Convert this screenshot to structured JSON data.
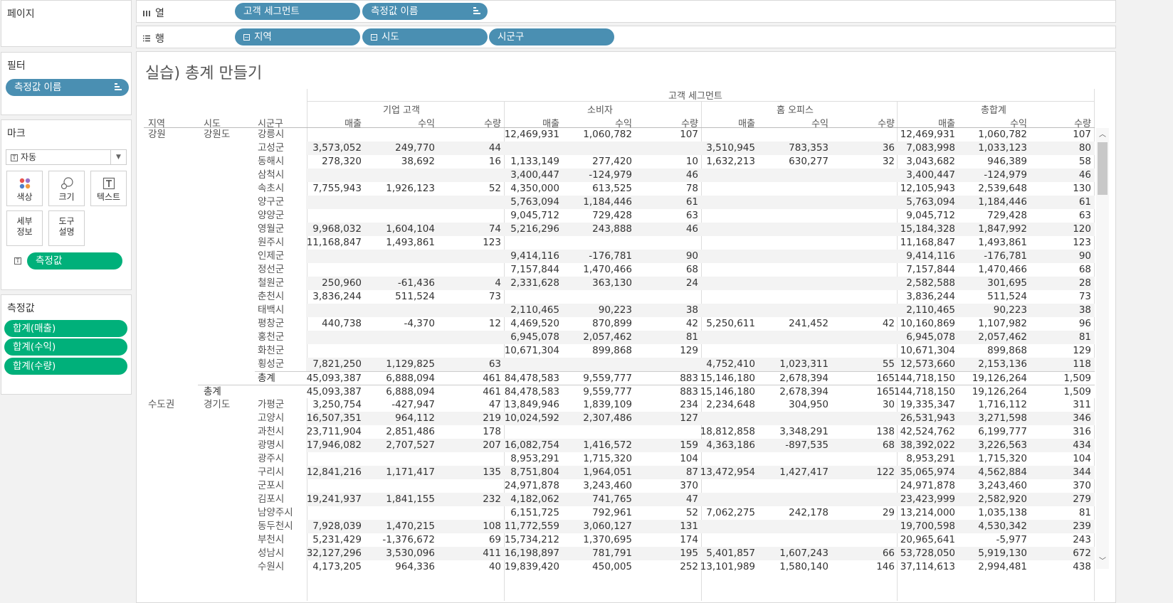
{
  "shelves": {
    "pages_label": "페이지",
    "columns_label": "열",
    "rows_label": "행",
    "column_pills": [
      "고객 세그먼트",
      "측정값 이름"
    ],
    "row_pills": [
      "지역",
      "시도",
      "시군구"
    ]
  },
  "filters": {
    "title": "필터",
    "pill": "측정값 이름"
  },
  "marks": {
    "title": "마크",
    "type": "자동",
    "buttons": {
      "color": "색상",
      "size": "크기",
      "text": "텍스트",
      "detail_1": "세부",
      "detail_2": "정보",
      "tooltip_1": "도구",
      "tooltip_2": "설명"
    },
    "measure_pill": "측정값"
  },
  "measures": {
    "title": "측정값",
    "pills": [
      "합계(매출)",
      "합계(수익)",
      "합계(수량)"
    ]
  },
  "viz": {
    "title": "실습) 총계 만들기",
    "segment_header": "고객 세그먼트",
    "segments": [
      "기업 고객",
      "소비자",
      "홈 오피스",
      "총합계"
    ],
    "measure_names": [
      "매출",
      "수익",
      "수량"
    ],
    "row_headers": [
      "지역",
      "시도",
      "시군구"
    ]
  },
  "table": {
    "rows": [
      {
        "region": "강원",
        "sido": "강원도",
        "sigungu": "강릉시",
        "v": [
          "",
          "",
          "",
          "12,469,931",
          "1,060,782",
          "107",
          "",
          "",
          "",
          "12,469,931",
          "1,060,782",
          "107"
        ]
      },
      {
        "region": "",
        "sido": "",
        "sigungu": "고성군",
        "v": [
          "3,573,052",
          "249,770",
          "44",
          "",
          "",
          "",
          "3,510,945",
          "783,353",
          "36",
          "7,083,998",
          "1,033,123",
          "80"
        ]
      },
      {
        "region": "",
        "sido": "",
        "sigungu": "동해시",
        "v": [
          "278,320",
          "38,692",
          "16",
          "1,133,149",
          "277,420",
          "10",
          "1,632,213",
          "630,277",
          "32",
          "3,043,682",
          "946,389",
          "58"
        ]
      },
      {
        "region": "",
        "sido": "",
        "sigungu": "삼척시",
        "v": [
          "",
          "",
          "",
          "3,400,447",
          "-124,979",
          "46",
          "",
          "",
          "",
          "3,400,447",
          "-124,979",
          "46"
        ]
      },
      {
        "region": "",
        "sido": "",
        "sigungu": "속초시",
        "v": [
          "7,755,943",
          "1,926,123",
          "52",
          "4,350,000",
          "613,525",
          "78",
          "",
          "",
          "",
          "12,105,943",
          "2,539,648",
          "130"
        ]
      },
      {
        "region": "",
        "sido": "",
        "sigungu": "양구군",
        "v": [
          "",
          "",
          "",
          "5,763,094",
          "1,184,446",
          "61",
          "",
          "",
          "",
          "5,763,094",
          "1,184,446",
          "61"
        ]
      },
      {
        "region": "",
        "sido": "",
        "sigungu": "양양군",
        "v": [
          "",
          "",
          "",
          "9,045,712",
          "729,428",
          "63",
          "",
          "",
          "",
          "9,045,712",
          "729,428",
          "63"
        ]
      },
      {
        "region": "",
        "sido": "",
        "sigungu": "영월군",
        "v": [
          "9,968,032",
          "1,604,104",
          "74",
          "5,216,296",
          "243,888",
          "46",
          "",
          "",
          "",
          "15,184,328",
          "1,847,992",
          "120"
        ]
      },
      {
        "region": "",
        "sido": "",
        "sigungu": "원주시",
        "v": [
          "11,168,847",
          "1,493,861",
          "123",
          "",
          "",
          "",
          "",
          "",
          "",
          "11,168,847",
          "1,493,861",
          "123"
        ]
      },
      {
        "region": "",
        "sido": "",
        "sigungu": "인제군",
        "v": [
          "",
          "",
          "",
          "9,414,116",
          "-176,781",
          "90",
          "",
          "",
          "",
          "9,414,116",
          "-176,781",
          "90"
        ]
      },
      {
        "region": "",
        "sido": "",
        "sigungu": "정선군",
        "v": [
          "",
          "",
          "",
          "7,157,844",
          "1,470,466",
          "68",
          "",
          "",
          "",
          "7,157,844",
          "1,470,466",
          "68"
        ]
      },
      {
        "region": "",
        "sido": "",
        "sigungu": "철원군",
        "v": [
          "250,960",
          "-61,436",
          "4",
          "2,331,628",
          "363,130",
          "24",
          "",
          "",
          "",
          "2,582,588",
          "301,695",
          "28"
        ]
      },
      {
        "region": "",
        "sido": "",
        "sigungu": "춘천시",
        "v": [
          "3,836,244",
          "511,524",
          "73",
          "",
          "",
          "",
          "",
          "",
          "",
          "3,836,244",
          "511,524",
          "73"
        ]
      },
      {
        "region": "",
        "sido": "",
        "sigungu": "태백시",
        "v": [
          "",
          "",
          "",
          "2,110,465",
          "90,223",
          "38",
          "",
          "",
          "",
          "2,110,465",
          "90,223",
          "38"
        ]
      },
      {
        "region": "",
        "sido": "",
        "sigungu": "평창군",
        "v": [
          "440,738",
          "-4,370",
          "12",
          "4,469,520",
          "870,899",
          "42",
          "5,250,611",
          "241,452",
          "42",
          "10,160,869",
          "1,107,982",
          "96"
        ]
      },
      {
        "region": "",
        "sido": "",
        "sigungu": "홍천군",
        "v": [
          "",
          "",
          "",
          "6,945,078",
          "2,057,462",
          "81",
          "",
          "",
          "",
          "6,945,078",
          "2,057,462",
          "81"
        ]
      },
      {
        "region": "",
        "sido": "",
        "sigungu": "화천군",
        "v": [
          "",
          "",
          "",
          "10,671,304",
          "899,868",
          "129",
          "",
          "",
          "",
          "10,671,304",
          "899,868",
          "129"
        ]
      },
      {
        "region": "",
        "sido": "",
        "sigungu": "횡성군",
        "v": [
          "7,821,250",
          "1,129,825",
          "63",
          "",
          "",
          "",
          "4,752,410",
          "1,023,311",
          "55",
          "12,573,660",
          "2,153,136",
          "118"
        ]
      },
      {
        "region": "",
        "sido": "",
        "sigungu": "총계",
        "total": "sigungu",
        "v": [
          "45,093,387",
          "6,888,094",
          "461",
          "84,478,583",
          "9,559,777",
          "883",
          "15,146,180",
          "2,678,394",
          "165",
          "144,718,150",
          "19,126,264",
          "1,509"
        ]
      },
      {
        "region": "",
        "sido": "총계",
        "sigungu": "",
        "total": "sido",
        "v": [
          "45,093,387",
          "6,888,094",
          "461",
          "84,478,583",
          "9,559,777",
          "883",
          "15,146,180",
          "2,678,394",
          "165",
          "144,718,150",
          "19,126,264",
          "1,509"
        ]
      },
      {
        "region": "수도권",
        "sido": "경기도",
        "sigungu": "가평군",
        "v": [
          "3,250,754",
          "-427,947",
          "47",
          "13,849,946",
          "1,839,109",
          "234",
          "2,234,648",
          "304,950",
          "30",
          "19,335,347",
          "1,716,112",
          "311"
        ]
      },
      {
        "region": "",
        "sido": "",
        "sigungu": "고양시",
        "v": [
          "16,507,351",
          "964,112",
          "219",
          "10,024,592",
          "2,307,486",
          "127",
          "",
          "",
          "",
          "26,531,943",
          "3,271,598",
          "346"
        ]
      },
      {
        "region": "",
        "sido": "",
        "sigungu": "과천시",
        "v": [
          "23,711,904",
          "2,851,486",
          "178",
          "",
          "",
          "",
          "18,812,858",
          "3,348,291",
          "138",
          "42,524,762",
          "6,199,777",
          "316"
        ]
      },
      {
        "region": "",
        "sido": "",
        "sigungu": "광명시",
        "v": [
          "17,946,082",
          "2,707,527",
          "207",
          "16,082,754",
          "1,416,572",
          "159",
          "4,363,186",
          "-897,535",
          "68",
          "38,392,022",
          "3,226,563",
          "434"
        ]
      },
      {
        "region": "",
        "sido": "",
        "sigungu": "광주시",
        "v": [
          "",
          "",
          "",
          "8,953,291",
          "1,715,320",
          "104",
          "",
          "",
          "",
          "8,953,291",
          "1,715,320",
          "104"
        ]
      },
      {
        "region": "",
        "sido": "",
        "sigungu": "구리시",
        "v": [
          "12,841,216",
          "1,171,417",
          "135",
          "8,751,804",
          "1,964,051",
          "87",
          "13,472,954",
          "1,427,417",
          "122",
          "35,065,974",
          "4,562,884",
          "344"
        ]
      },
      {
        "region": "",
        "sido": "",
        "sigungu": "군포시",
        "v": [
          "",
          "",
          "",
          "24,971,878",
          "3,243,460",
          "370",
          "",
          "",
          "",
          "24,971,878",
          "3,243,460",
          "370"
        ]
      },
      {
        "region": "",
        "sido": "",
        "sigungu": "김포시",
        "v": [
          "19,241,937",
          "1,841,155",
          "232",
          "4,182,062",
          "741,765",
          "47",
          "",
          "",
          "",
          "23,423,999",
          "2,582,920",
          "279"
        ]
      },
      {
        "region": "",
        "sido": "",
        "sigungu": "남양주시",
        "v": [
          "",
          "",
          "",
          "6,151,725",
          "792,961",
          "52",
          "7,062,275",
          "242,178",
          "29",
          "13,214,000",
          "1,035,138",
          "81"
        ]
      },
      {
        "region": "",
        "sido": "",
        "sigungu": "동두천시",
        "v": [
          "7,928,039",
          "1,470,215",
          "108",
          "11,772,559",
          "3,060,127",
          "131",
          "",
          "",
          "",
          "19,700,598",
          "4,530,342",
          "239"
        ]
      },
      {
        "region": "",
        "sido": "",
        "sigungu": "부천시",
        "v": [
          "5,231,429",
          "-1,376,672",
          "69",
          "15,734,212",
          "1,370,695",
          "174",
          "",
          "",
          "",
          "20,965,641",
          "-5,977",
          "243"
        ]
      },
      {
        "region": "",
        "sido": "",
        "sigungu": "성남시",
        "v": [
          "32,127,296",
          "3,530,096",
          "411",
          "16,198,897",
          "781,791",
          "195",
          "5,401,857",
          "1,607,243",
          "66",
          "53,728,050",
          "5,919,130",
          "672"
        ]
      },
      {
        "region": "",
        "sido": "",
        "sigungu": "수원시",
        "v": [
          "4,173,205",
          "964,336",
          "40",
          "19,839,420",
          "450,005",
          "252",
          "13,101,989",
          "1,580,140",
          "146",
          "37,114,613",
          "2,994,481",
          "438"
        ]
      }
    ]
  }
}
